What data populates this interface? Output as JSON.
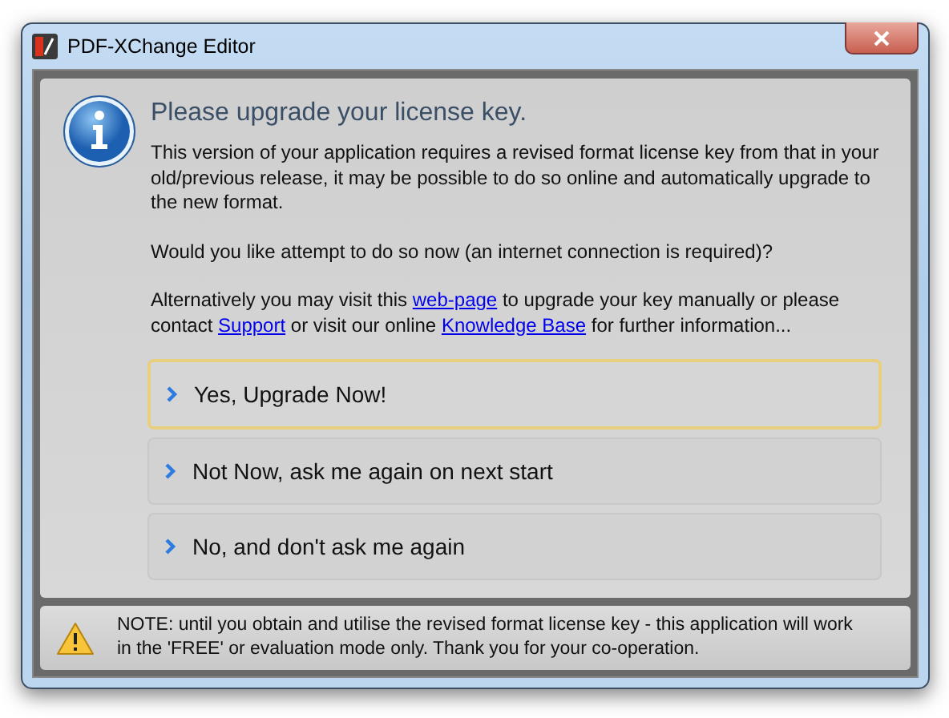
{
  "window": {
    "title": "PDF-XChange Editor"
  },
  "heading": "Please upgrade your license key.",
  "paragraphs": [
    [
      {
        "kind": "text",
        "text": "This version of your application requires a revised format license key from that in your old/previous release, it may be possible to do so online and automatically upgrade to the new format."
      }
    ],
    [
      {
        "kind": "text",
        "text": "Would you like attempt to do so now (an internet connection is required)?"
      }
    ],
    [
      {
        "kind": "text",
        "text": "Alternatively you may visit this "
      },
      {
        "kind": "link",
        "text": "web-page"
      },
      {
        "kind": "text",
        "text": " to upgrade your key manually or please contact "
      },
      {
        "kind": "link",
        "text": "Support"
      },
      {
        "kind": "text",
        "text": " or visit our online "
      },
      {
        "kind": "link",
        "text": "Knowledge Base"
      },
      {
        "kind": "text",
        "text": " for further information..."
      }
    ]
  ],
  "options": [
    {
      "label": "Yes, Upgrade Now!",
      "selected": true
    },
    {
      "label": "Not Now, ask me again on next start",
      "selected": false
    },
    {
      "label": "No, and don't ask me again",
      "selected": false
    }
  ],
  "note": "NOTE: until you obtain and utilise the revised format license key - this application will work in the 'FREE' or evaluation mode only. Thank you for your co-operation."
}
